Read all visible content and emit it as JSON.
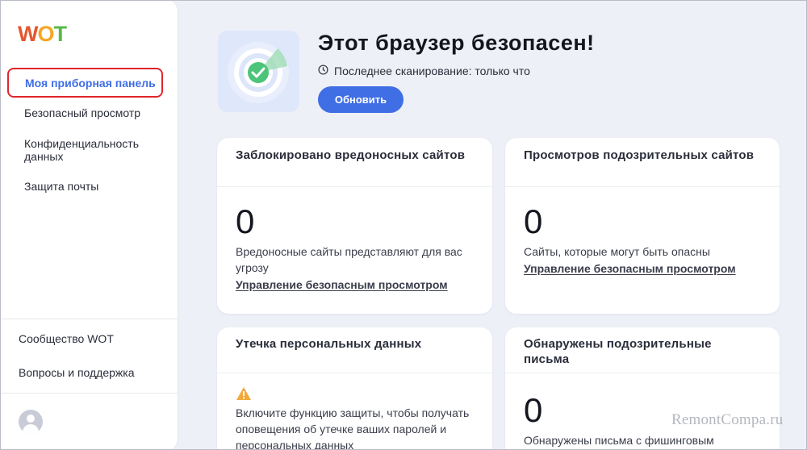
{
  "sidebar": {
    "logo": {
      "w": "W",
      "o": "O",
      "t": "T"
    },
    "items": [
      {
        "label": "Моя приборная панель"
      },
      {
        "label": "Безопасный просмотр"
      },
      {
        "label": "Конфиденциальность данных"
      },
      {
        "label": "Защита почты"
      }
    ],
    "bottom": [
      {
        "label": "Сообщество WOT"
      },
      {
        "label": "Вопросы и поддержка"
      }
    ]
  },
  "hero": {
    "title": "Этот браузер безопасен!",
    "scan_text": "Последнее сканирование: только что",
    "button": "Обновить"
  },
  "cards": {
    "blocked": {
      "title": "Заблокировано вредоносных сайтов",
      "count": "0",
      "text": "Вредоносные сайты представляют для вас угрозу",
      "link": "Управление безопасным просмотром"
    },
    "suspicious_views": {
      "title": "Просмотров подозрительных сайтов",
      "count": "0",
      "text": "Сайты, которые могут быть опасны",
      "link": "Управление безопасным просмотром"
    },
    "leak": {
      "title": "Утечка персональных данных",
      "text": "Включите функцию защиты, чтобы получать оповещения об утечке ваших паролей и персональных данных"
    },
    "emails": {
      "title": "Обнаружены подозрительные письма",
      "count": "0",
      "text": "Обнаружены письма с фишинговым"
    }
  },
  "watermark": "RemontCompa.ru",
  "colors": {
    "accent": "#3f6ee5",
    "highlight": "#e0262d",
    "safe": "#4cc47a"
  }
}
